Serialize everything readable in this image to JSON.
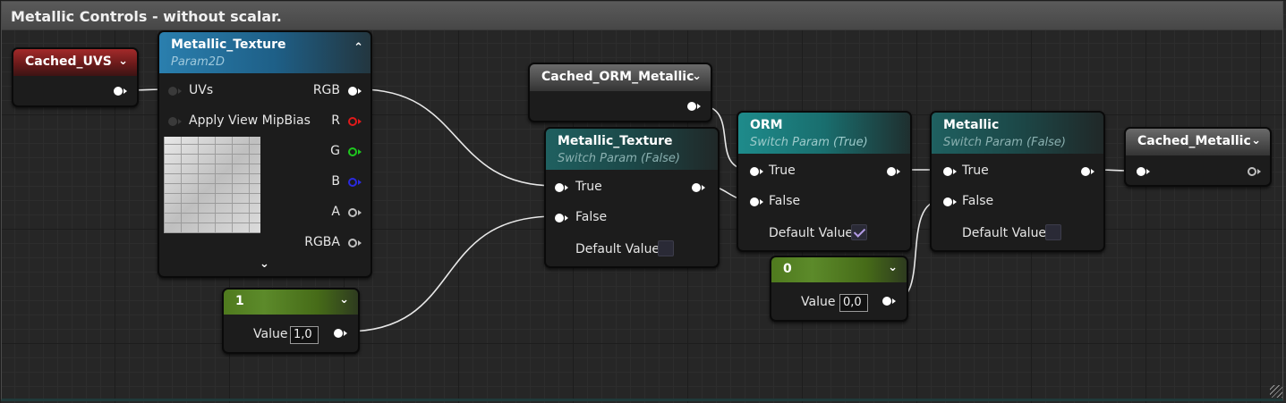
{
  "comment": {
    "title": "Metallic Controls - without scalar."
  },
  "nodes": {
    "cached_uvs": {
      "title": "Cached_UVS"
    },
    "metallic_texture_param": {
      "title": "Metallic_Texture",
      "subtitle": "Param2D",
      "inputs": [
        "UVs",
        "Apply View MipBias"
      ],
      "outputs": [
        "RGB",
        "R",
        "G",
        "B",
        "A",
        "RGBA"
      ]
    },
    "cached_orm_metallic": {
      "title": "Cached_ORM_Metallic"
    },
    "metallic_texture_switch": {
      "title": "Metallic_Texture",
      "subtitle": "Switch Param (False)",
      "true_label": "True",
      "false_label": "False",
      "default_label": "Default Value",
      "default_checked": false
    },
    "orm_switch": {
      "title": "ORM",
      "subtitle": "Switch Param (True)",
      "true_label": "True",
      "false_label": "False",
      "default_label": "Default Value",
      "default_checked": true
    },
    "metallic_switch": {
      "title": "Metallic",
      "subtitle": "Switch Param (False)",
      "true_label": "True",
      "false_label": "False",
      "default_label": "Default Value",
      "default_checked": false
    },
    "cached_metallic": {
      "title": "Cached_Metallic"
    },
    "const_one": {
      "title": "1",
      "value_label": "Value",
      "value": "1,0"
    },
    "const_zero": {
      "title": "0",
      "value_label": "Value",
      "value": "0,0"
    }
  },
  "colors": {
    "named_reroute_red": "#a32a2a",
    "texture_param_blue": "#2a7fae",
    "switch_teal": "#1e8b8b",
    "constant_green": "#5c8a2a",
    "checkbox_check": "#b49ce6",
    "pin_r": "#e01a1a",
    "pin_g": "#1ec81e",
    "pin_b": "#2a2ae0"
  },
  "icons": {
    "dropdown": "chevron-down-icon",
    "collapse": "chevron-up-icon",
    "expand": "chevron-down-icon"
  }
}
